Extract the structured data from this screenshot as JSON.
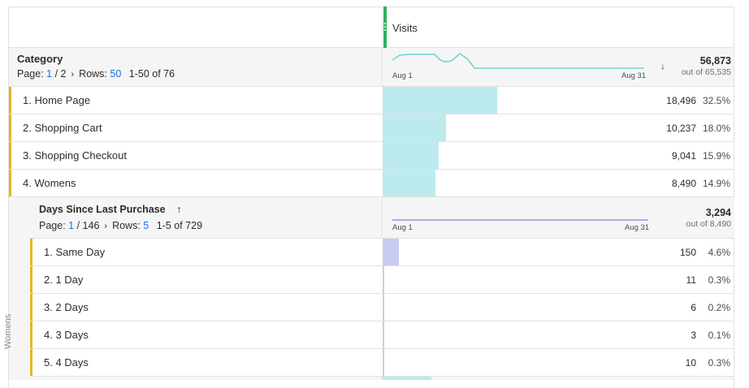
{
  "metric": {
    "name": "Visits"
  },
  "dimension": {
    "name": "Category",
    "pager": {
      "page_label": "Page:",
      "page": "1",
      "of_pages": "/ 2",
      "rows_label": "Rows:",
      "rows": "50",
      "range": "1-50 of 76"
    },
    "axis": {
      "start": "Aug 1",
      "end": "Aug 31"
    },
    "total": {
      "value": "56,873",
      "out_of": "out of 65,535"
    },
    "rows": [
      {
        "label": "1. Home Page",
        "value": "18,496",
        "pct": "32.5%",
        "share": 0.325
      },
      {
        "label": "2. Shopping Cart",
        "value": "10,237",
        "pct": "18.0%",
        "share": 0.18
      },
      {
        "label": "3. Shopping Checkout",
        "value": "9,041",
        "pct": "15.9%",
        "share": 0.159
      },
      {
        "label": "4. Womens",
        "value": "8,490",
        "pct": "14.9%",
        "share": 0.149
      }
    ]
  },
  "breakdown": {
    "parent_label": "Womens",
    "name": "Days Since Last Purchase",
    "pager": {
      "page_label": "Page:",
      "page": "1",
      "of_pages": "/ 146",
      "rows_label": "Rows:",
      "rows": "5",
      "range": "1-5 of 729"
    },
    "axis": {
      "start": "Aug 1",
      "end": "Aug 31"
    },
    "total": {
      "value": "3,294",
      "out_of": "out of 8,490"
    },
    "rows": [
      {
        "label": "1. Same Day",
        "value": "150",
        "pct": "4.6%",
        "share": 0.046
      },
      {
        "label": "2. 1 Day",
        "value": "11",
        "pct": "0.3%",
        "share": 0.003
      },
      {
        "label": "3. 2 Days",
        "value": "6",
        "pct": "0.2%",
        "share": 0.002
      },
      {
        "label": "4. 3 Days",
        "value": "3",
        "pct": "0.1%",
        "share": 0.001
      },
      {
        "label": "5. 4 Days",
        "value": "10",
        "pct": "0.3%",
        "share": 0.003
      }
    ]
  },
  "icons": {
    "sort_desc": "arrow-down-icon",
    "sort_asc": "arrow-up-icon",
    "next_page": "chevron-right-icon",
    "column_handle": "drag-handle-icon"
  },
  "colors": {
    "accent": "#e5b622",
    "visits_bar": "#bdeaee",
    "breakdown_bar": "#c9cbf2",
    "sparkline": "#6fd3d8",
    "breakdown_line": "#8f93e0",
    "handle": "#2fb15a",
    "link": "#1473e6"
  }
}
